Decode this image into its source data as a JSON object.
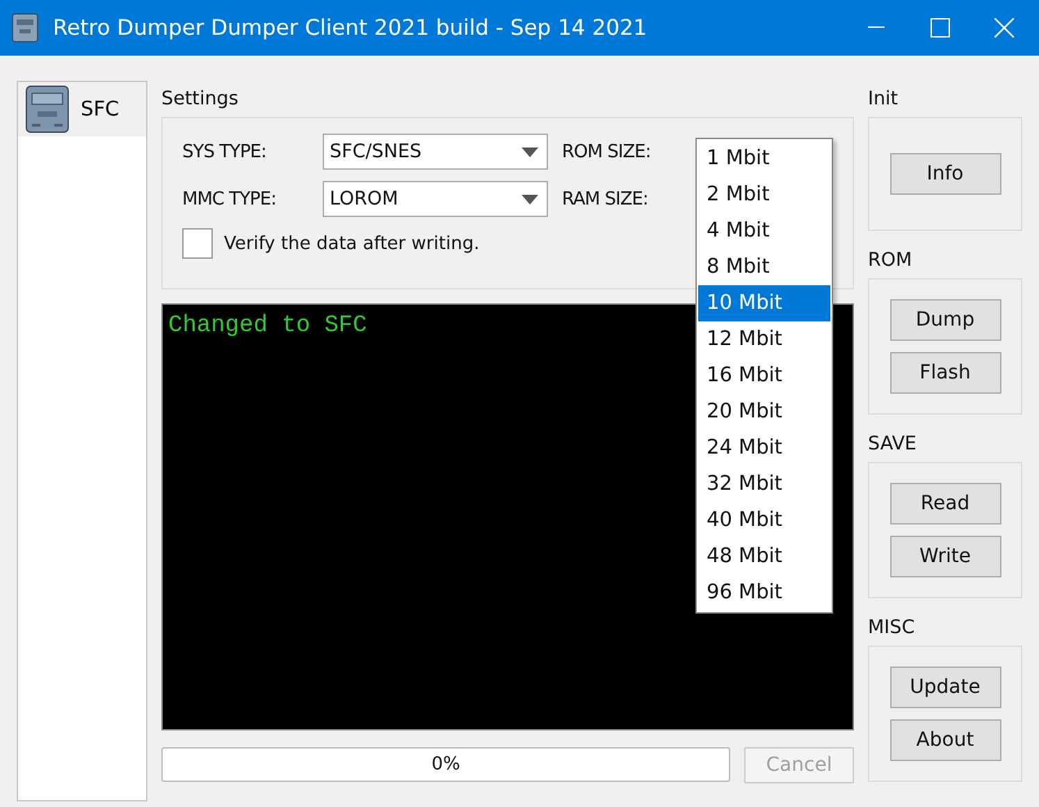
{
  "window": {
    "title": "Retro Dumper Dumper Client 2021 build - Sep 14 2021"
  },
  "sidebar": {
    "items": [
      {
        "label": "SFC",
        "selected": true
      }
    ]
  },
  "settings": {
    "title": "Settings",
    "sys_type": {
      "label": "SYS TYPE:",
      "value": "SFC/SNES"
    },
    "mmc_type": {
      "label": "MMC TYPE:",
      "value": "LOROM"
    },
    "rom_size": {
      "label": "ROM SIZE:"
    },
    "ram_size": {
      "label": "RAM SIZE:"
    },
    "verify": {
      "label": "Verify the data after writing.",
      "checked": false
    }
  },
  "rom_size_dropdown": [
    {
      "label": "1 Mbit",
      "selected": false
    },
    {
      "label": "2 Mbit",
      "selected": false
    },
    {
      "label": "4 Mbit",
      "selected": false
    },
    {
      "label": "8 Mbit",
      "selected": false
    },
    {
      "label": "10 Mbit",
      "selected": true
    },
    {
      "label": "12 Mbit",
      "selected": false
    },
    {
      "label": "16 Mbit",
      "selected": false
    },
    {
      "label": "20 Mbit",
      "selected": false
    },
    {
      "label": "24 Mbit",
      "selected": false
    },
    {
      "label": "32 Mbit",
      "selected": false
    },
    {
      "label": "40 Mbit",
      "selected": false
    },
    {
      "label": "48 Mbit",
      "selected": false
    },
    {
      "label": "96 Mbit",
      "selected": false
    }
  ],
  "console": {
    "lines": [
      "Changed to SFC"
    ]
  },
  "progress": {
    "text": "0%",
    "level": 0
  },
  "cancel_button": {
    "label": "Cancel",
    "disabled": true
  },
  "groups": [
    {
      "title": "Init",
      "buttons": [
        "Info"
      ]
    },
    {
      "title": "ROM",
      "buttons": [
        "Dump",
        "Flash"
      ]
    },
    {
      "title": "SAVE",
      "buttons": [
        "Read",
        "Write"
      ]
    },
    {
      "title": "MISC",
      "buttons": [
        "Update",
        "About"
      ]
    }
  ]
}
